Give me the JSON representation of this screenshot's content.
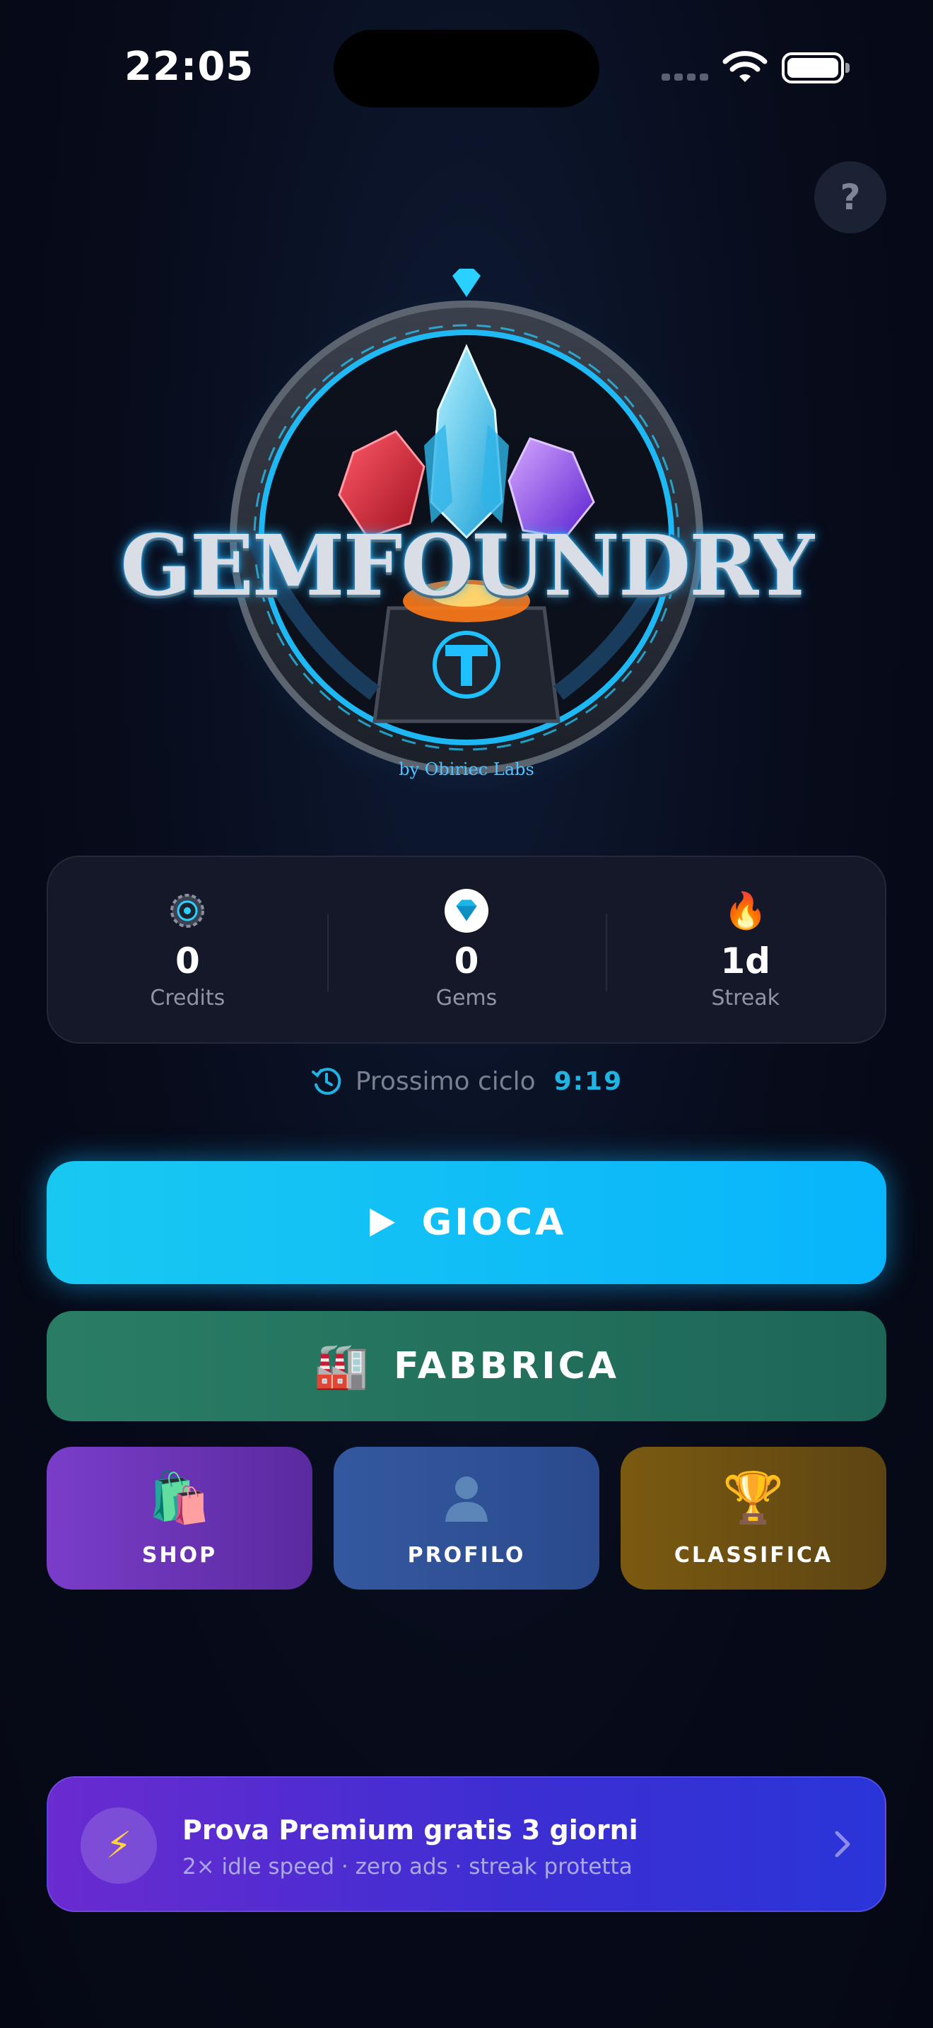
{
  "status_bar": {
    "time": "22:05"
  },
  "help": {
    "label": "?"
  },
  "logo": {
    "title": "GEMFOUNDRY",
    "caption": "by Obiriec Labs"
  },
  "stats": [
    {
      "icon": "gear-credits-icon",
      "value": "0",
      "label": "Credits"
    },
    {
      "icon": "gem-icon",
      "value": "0",
      "label": "Gems"
    },
    {
      "icon": "fire-icon",
      "value": "1d",
      "label": "Streak"
    }
  ],
  "cycle": {
    "label": "Prossimo ciclo",
    "time": "9:19"
  },
  "buttons": {
    "play": "GIOCA",
    "factory": "FABBRICA",
    "shop": "SHOP",
    "profile": "PROFILO",
    "ranking": "CLASSIFICA"
  },
  "premium": {
    "title": "Prova Premium gratis 3 giorni",
    "subtitle": "2× idle speed · zero ads · streak protetta"
  },
  "colors": {
    "background": "#070b1a",
    "accent": "#10b4f4",
    "factory": "#267563",
    "shop": "#6a34b4",
    "profile": "#2f5196",
    "ranking": "#6c4f12",
    "premium": "#4a2ed2"
  }
}
